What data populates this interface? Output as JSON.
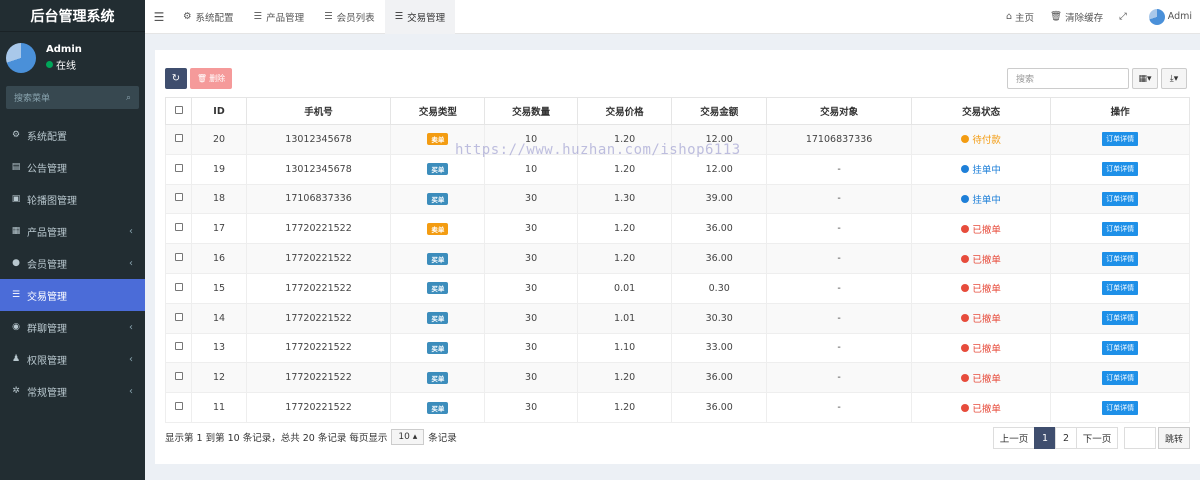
{
  "brand": "后台管理系统",
  "user": {
    "name": "Admin",
    "status": "在线"
  },
  "sidebar": {
    "search_placeholder": "搜索菜单",
    "items": [
      {
        "label": "系统配置",
        "icon": "gear-icon",
        "glyph": "⚙",
        "has_children": false,
        "active": false
      },
      {
        "label": "公告管理",
        "icon": "document-icon",
        "glyph": "▤",
        "has_children": false,
        "active": false
      },
      {
        "label": "轮播图管理",
        "icon": "image-icon",
        "glyph": "▣",
        "has_children": false,
        "active": false
      },
      {
        "label": "产品管理",
        "icon": "grid-icon",
        "glyph": "▦",
        "has_children": true,
        "active": false
      },
      {
        "label": "会员管理",
        "icon": "user-icon",
        "glyph": "●",
        "has_children": true,
        "active": false
      },
      {
        "label": "交易管理",
        "icon": "list-icon",
        "glyph": "☰",
        "has_children": false,
        "active": true
      },
      {
        "label": "群聊管理",
        "icon": "chat-icon",
        "glyph": "◉",
        "has_children": true,
        "active": false
      },
      {
        "label": "权限管理",
        "icon": "users-icon",
        "glyph": "♟",
        "has_children": true,
        "active": false
      },
      {
        "label": "常规管理",
        "icon": "cogs-icon",
        "glyph": "✲",
        "has_children": true,
        "active": false
      }
    ]
  },
  "topbar": {
    "tabs": [
      {
        "label": "系统配置",
        "icon": "gear-icon",
        "glyph": "⚙",
        "active": false
      },
      {
        "label": "产品管理",
        "icon": "list-icon",
        "glyph": "☰",
        "active": false
      },
      {
        "label": "会员列表",
        "icon": "list-icon",
        "glyph": "☰",
        "active": false
      },
      {
        "label": "交易管理",
        "icon": "list-icon",
        "glyph": "☰",
        "active": true
      }
    ],
    "home": "主页",
    "clear_cache": "清除缓存",
    "user": "Admi"
  },
  "toolbar": {
    "delete_label": "删除",
    "search_placeholder": "搜索"
  },
  "table": {
    "headers": [
      "ID",
      "手机号",
      "交易类型",
      "交易数量",
      "交易价格",
      "交易金额",
      "交易对象",
      "交易状态",
      "操作"
    ],
    "detail_label": "订单详情",
    "rows": [
      {
        "id": "20",
        "phone": "13012345678",
        "type": "卖单",
        "type_kind": "sell",
        "qty": "10",
        "price": "1.20",
        "amount": "12.00",
        "target": "17106837336",
        "status": "待付款",
        "status_color": "#f39c12"
      },
      {
        "id": "19",
        "phone": "13012345678",
        "type": "买单",
        "type_kind": "buy",
        "qty": "10",
        "price": "1.20",
        "amount": "12.00",
        "target": "-",
        "status": "挂单中",
        "status_color": "#1e7fd8"
      },
      {
        "id": "18",
        "phone": "17106837336",
        "type": "买单",
        "type_kind": "buy",
        "qty": "30",
        "price": "1.30",
        "amount": "39.00",
        "target": "-",
        "status": "挂单中",
        "status_color": "#1e7fd8"
      },
      {
        "id": "17",
        "phone": "17720221522",
        "type": "卖单",
        "type_kind": "sell",
        "qty": "30",
        "price": "1.20",
        "amount": "36.00",
        "target": "-",
        "status": "已撤单",
        "status_color": "#e74c3c"
      },
      {
        "id": "16",
        "phone": "17720221522",
        "type": "买单",
        "type_kind": "buy",
        "qty": "30",
        "price": "1.20",
        "amount": "36.00",
        "target": "-",
        "status": "已撤单",
        "status_color": "#e74c3c"
      },
      {
        "id": "15",
        "phone": "17720221522",
        "type": "买单",
        "type_kind": "buy",
        "qty": "30",
        "price": "0.01",
        "amount": "0.30",
        "target": "-",
        "status": "已撤单",
        "status_color": "#e74c3c"
      },
      {
        "id": "14",
        "phone": "17720221522",
        "type": "买单",
        "type_kind": "buy",
        "qty": "30",
        "price": "1.01",
        "amount": "30.30",
        "target": "-",
        "status": "已撤单",
        "status_color": "#e74c3c"
      },
      {
        "id": "13",
        "phone": "17720221522",
        "type": "买单",
        "type_kind": "buy",
        "qty": "30",
        "price": "1.10",
        "amount": "33.00",
        "target": "-",
        "status": "已撤单",
        "status_color": "#e74c3c"
      },
      {
        "id": "12",
        "phone": "17720221522",
        "type": "买单",
        "type_kind": "buy",
        "qty": "30",
        "price": "1.20",
        "amount": "36.00",
        "target": "-",
        "status": "已撤单",
        "status_color": "#e74c3c"
      },
      {
        "id": "11",
        "phone": "17720221522",
        "type": "买单",
        "type_kind": "buy",
        "qty": "30",
        "price": "1.20",
        "amount": "36.00",
        "target": "-",
        "status": "已撤单",
        "status_color": "#e74c3c"
      }
    ]
  },
  "footer": {
    "summary": "显示第 1 到第 10 条记录，总共 20 条记录 每页显示",
    "page_size": "10",
    "suffix": "条记录",
    "prev": "上一页",
    "pages": [
      "1",
      "2"
    ],
    "current_page": "1",
    "next": "下一页",
    "jump": "跳转"
  },
  "watermark": "https://www.huzhan.com/ishop6113"
}
